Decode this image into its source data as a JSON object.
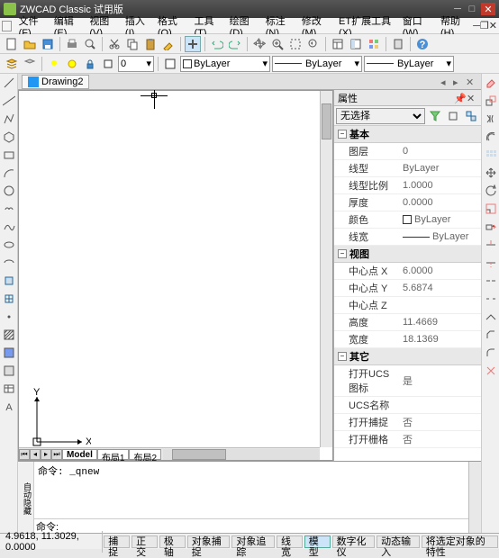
{
  "app": {
    "title": "ZWCAD Classic 试用版"
  },
  "menus": [
    "文件(F)",
    "编辑(E)",
    "视图(V)",
    "插入(I)",
    "格式(O)",
    "工具(T)",
    "绘图(D)",
    "标注(N)",
    "修改(M)",
    "ET扩展工具(X)",
    "窗口(W)",
    "帮助(H)"
  ],
  "doc": {
    "name": "Drawing2"
  },
  "layer_combo": {
    "current": "ByLayer"
  },
  "linetype_combo": {
    "current": "ByLayer"
  },
  "lineweight_combo": {
    "current": "ByLayer"
  },
  "layout_tabs": {
    "model": "Model",
    "layout1": "布局1",
    "layout2": "布局2"
  },
  "props": {
    "title": "属性",
    "selection": "无选择",
    "groups": {
      "basic": "基本",
      "view": "视图",
      "misc": "其它"
    },
    "rows": {
      "layer": {
        "k": "图层",
        "v": "0"
      },
      "linetype": {
        "k": "线型",
        "v": "ByLayer"
      },
      "ltscale": {
        "k": "线型比例",
        "v": "1.0000"
      },
      "thickness": {
        "k": "厚度",
        "v": "0.0000"
      },
      "color": {
        "k": "颜色",
        "v": "ByLayer"
      },
      "lineweight": {
        "k": "线宽",
        "v": "ByLayer"
      },
      "centerx": {
        "k": "中心点 X",
        "v": "6.0000"
      },
      "centery": {
        "k": "中心点 Y",
        "v": "5.6874"
      },
      "centerz": {
        "k": "中心点 Z",
        "v": ""
      },
      "height": {
        "k": "高度",
        "v": "11.4669"
      },
      "width": {
        "k": "宽度",
        "v": "18.1369"
      },
      "ucsicon": {
        "k": "打开UCS图标",
        "v": "是"
      },
      "ucsname": {
        "k": "UCS名称",
        "v": ""
      },
      "grips": {
        "k": "打开捕捉",
        "v": "否"
      },
      "grid": {
        "k": "打开栅格",
        "v": "否"
      }
    }
  },
  "cmd": {
    "history": "命令: _qnew",
    "side": "自动隐藏",
    "prompt": "命令:"
  },
  "status": {
    "coords": "4.9618, 11.3029, 0.0000",
    "buttons": [
      "捕捉",
      "正交",
      "极轴",
      "对象捕捉",
      "对象追踪",
      "线宽",
      "模型",
      "数字化仪",
      "动态输入",
      "将选定对象的特性"
    ],
    "active": "模型"
  },
  "ucs": {
    "x": "X",
    "y": "Y"
  },
  "icons": {
    "new": "new",
    "open": "open",
    "save": "save",
    "print": "print",
    "preview": "preview",
    "cut": "cut",
    "copy": "copy",
    "paste": "paste",
    "match": "match",
    "undo": "undo",
    "redo": "redo",
    "pan": "pan",
    "zoom": "zoom",
    "zoomext": "zoom-ext",
    "dist": "dist",
    "help": "help",
    "lock": "lock",
    "bulb": "bulb",
    "freeze": "freeze",
    "color": "color",
    "line": "line",
    "pline": "pline",
    "polygon": "polygon",
    "rect": "rect",
    "arc": "arc",
    "circle": "circle",
    "spline": "spline",
    "ellipse": "ellipse",
    "earc": "earc",
    "point": "point",
    "block": "block",
    "hatch": "hatch",
    "region": "region",
    "table": "table",
    "text": "text",
    "mtext": "mtext",
    "erase": "erase",
    "copy2": "copy-mod",
    "mirror": "mirror",
    "offset": "offset",
    "array": "array",
    "move": "move",
    "rotate": "rotate",
    "scale": "scale",
    "stretch": "stretch",
    "trim": "trim",
    "extend": "extend",
    "break": "break",
    "chamfer": "chamfer",
    "fillet": "fillet",
    "explode": "explode"
  }
}
